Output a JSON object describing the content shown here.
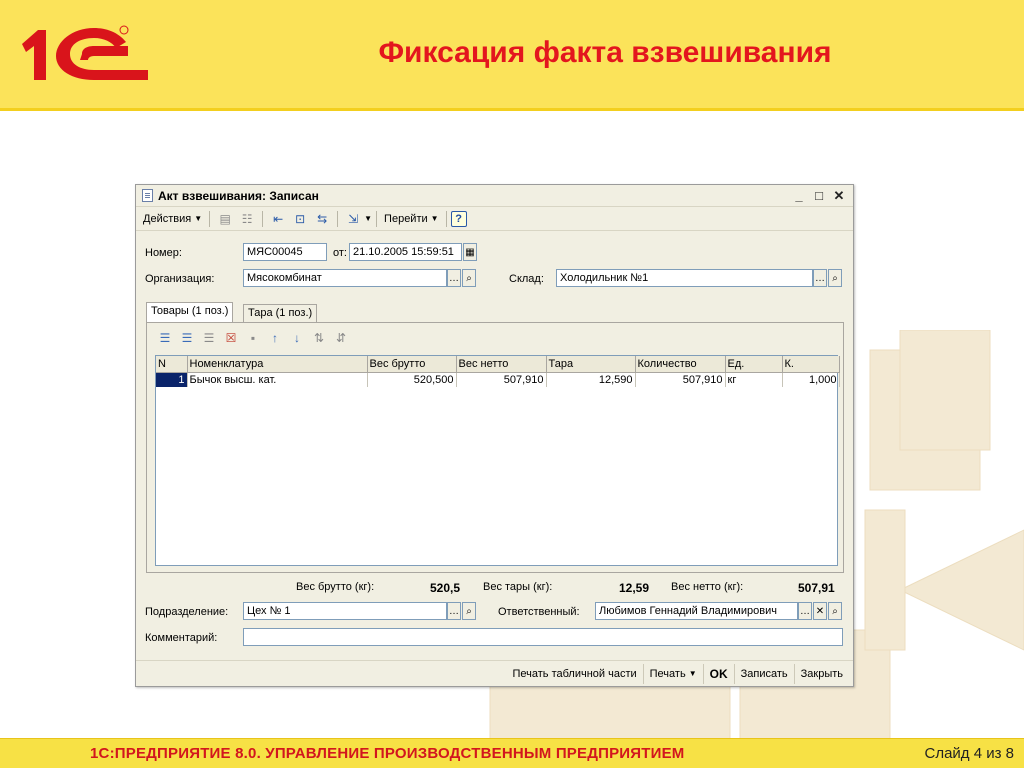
{
  "slide": {
    "title": "Фиксация факта взвешивания",
    "footer": "1С:ПРЕДПРИЯТИЕ 8.0. УПРАВЛЕНИЕ ПРОИЗВОДСТВЕННЫМ ПРЕДПРИЯТИЕМ",
    "slide_number": "Слайд 4 из 8"
  },
  "colors": {
    "header_bg": "#fbe35a",
    "title_red": "#e3161e",
    "logo_red": "#d9141b"
  },
  "window": {
    "title": "Акт взвешивания: Записан",
    "controls": [
      "minimize-icon",
      "maximize-icon",
      "close-icon"
    ]
  },
  "toolbar": {
    "actions_label": "Действия",
    "goto_label": "Перейти",
    "help_label": "?"
  },
  "form": {
    "number_label": "Номер:",
    "number_value": "МЯС00045",
    "from_label": "от:",
    "date_value": "21.10.2005 15:59:51",
    "org_label": "Организация:",
    "org_value": "Мясокомбинат",
    "warehouse_label": "Склад:",
    "warehouse_value": "Холодильник №1"
  },
  "tabs": [
    {
      "label": "Товары (1 поз.)",
      "active": true
    },
    {
      "label": "Тара (1 поз.)",
      "active": false
    }
  ],
  "grid": {
    "columns": [
      "N",
      "Номенклатура",
      "Вес брутто",
      "Вес нетто",
      "Тара",
      "Количество",
      "Ед.",
      "К."
    ],
    "rows": [
      [
        "1",
        "Бычок высш. кат.",
        "520,500",
        "507,910",
        "12,590",
        "507,910",
        "кг",
        "1,000"
      ]
    ]
  },
  "totals": {
    "gross_label": "Вес брутто (кг):",
    "gross_value": "520,5",
    "tare_label": "Вес тары (кг):",
    "tare_value": "12,59",
    "net_label": "Вес нетто (кг):",
    "net_value": "507,91"
  },
  "footer_form": {
    "division_label": "Подразделение:",
    "division_value": "Цех № 1",
    "responsible_label": "Ответственный:",
    "responsible_value": "Любимов Геннадий Владимирович",
    "comment_label": "Комментарий:",
    "comment_value": ""
  },
  "bottom_buttons": {
    "print_table": "Печать табличной части",
    "print": "Печать",
    "ok": "OK",
    "save": "Записать",
    "close": "Закрыть"
  }
}
